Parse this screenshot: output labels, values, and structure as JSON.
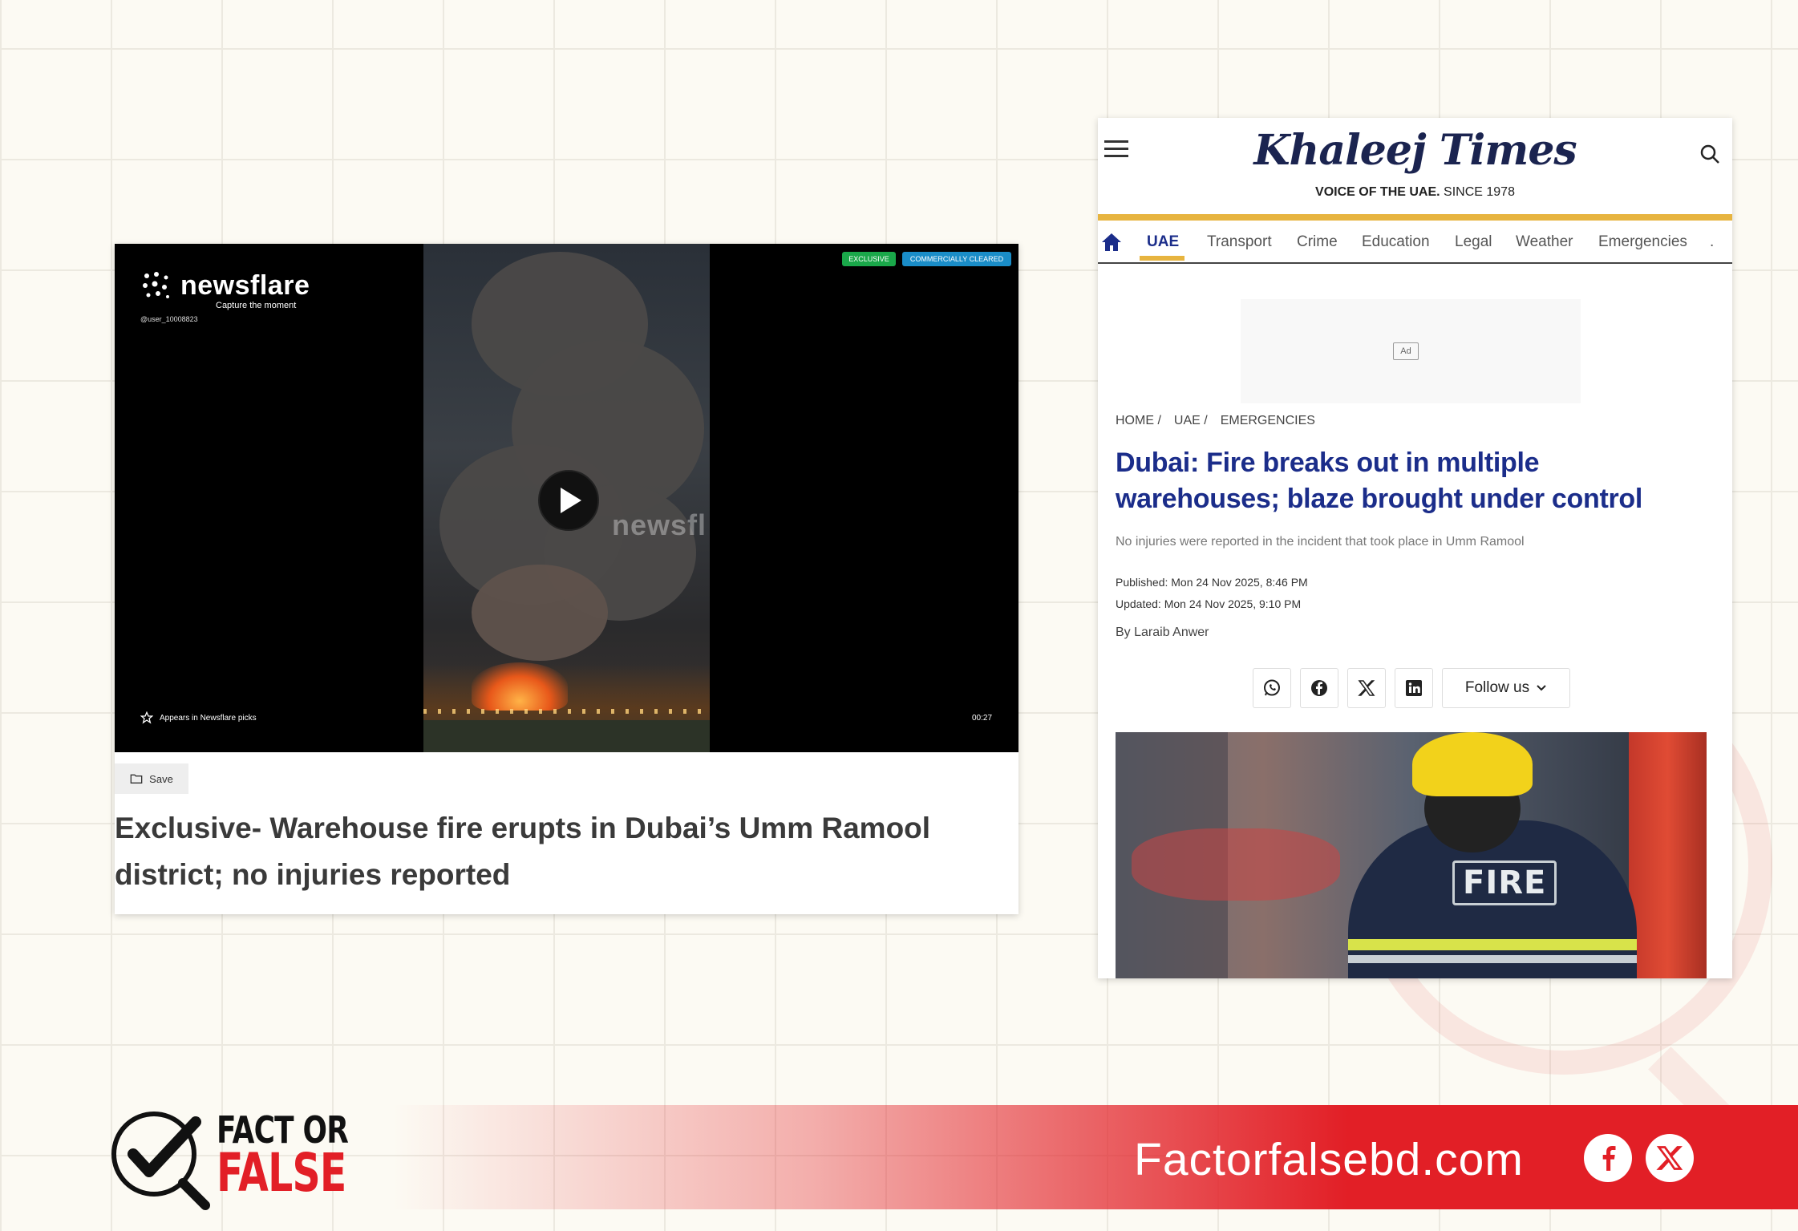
{
  "newsflare": {
    "brand": "newsflare",
    "tagline": "Capture the moment",
    "user": "@user_10008823",
    "badge_exclusive": "EXCLUSIVE",
    "badge_cleared": "COMMERCIALLY CLEARED",
    "watermark": "newsfl",
    "picks_label": "Appears in Newsflare picks",
    "duration": "00:27",
    "save_label": "Save",
    "title": "Exclusive- Warehouse fire erupts in Dubai’s Umm Ramool district; no injuries reported"
  },
  "khaleej": {
    "logo": "Khaleej Times",
    "voice_bold": "VOICE OF THE UAE.",
    "voice_rest": " SINCE 1978",
    "nav": [
      "UAE",
      "Transport",
      "Crime",
      "Education",
      "Legal",
      "Weather",
      "Emergencies",
      "."
    ],
    "ad_label": "Ad",
    "breadcrumb": [
      "HOME /",
      "UAE /",
      "EMERGENCIES"
    ],
    "headline": "Dubai: Fire breaks out in multiple warehouses; blaze brought under control",
    "subheadline": "No injuries were reported in the incident that took place in Umm Ramool",
    "published": "Published: Mon 24 Nov 2025, 8:46 PM",
    "updated": "Updated: Mon 24 Nov 2025, 9:10 PM",
    "byline": "By Laraib Anwer",
    "follow_label": "Follow us",
    "photo_text": "FIRE",
    "accent": "#e7b43f",
    "headline_color": "#1b2d8a"
  },
  "footer": {
    "fof_fact": "FACT OR",
    "fof_false": "FALSE",
    "site": "Factorfalsebd.com",
    "brand_red": "#e21f26"
  }
}
